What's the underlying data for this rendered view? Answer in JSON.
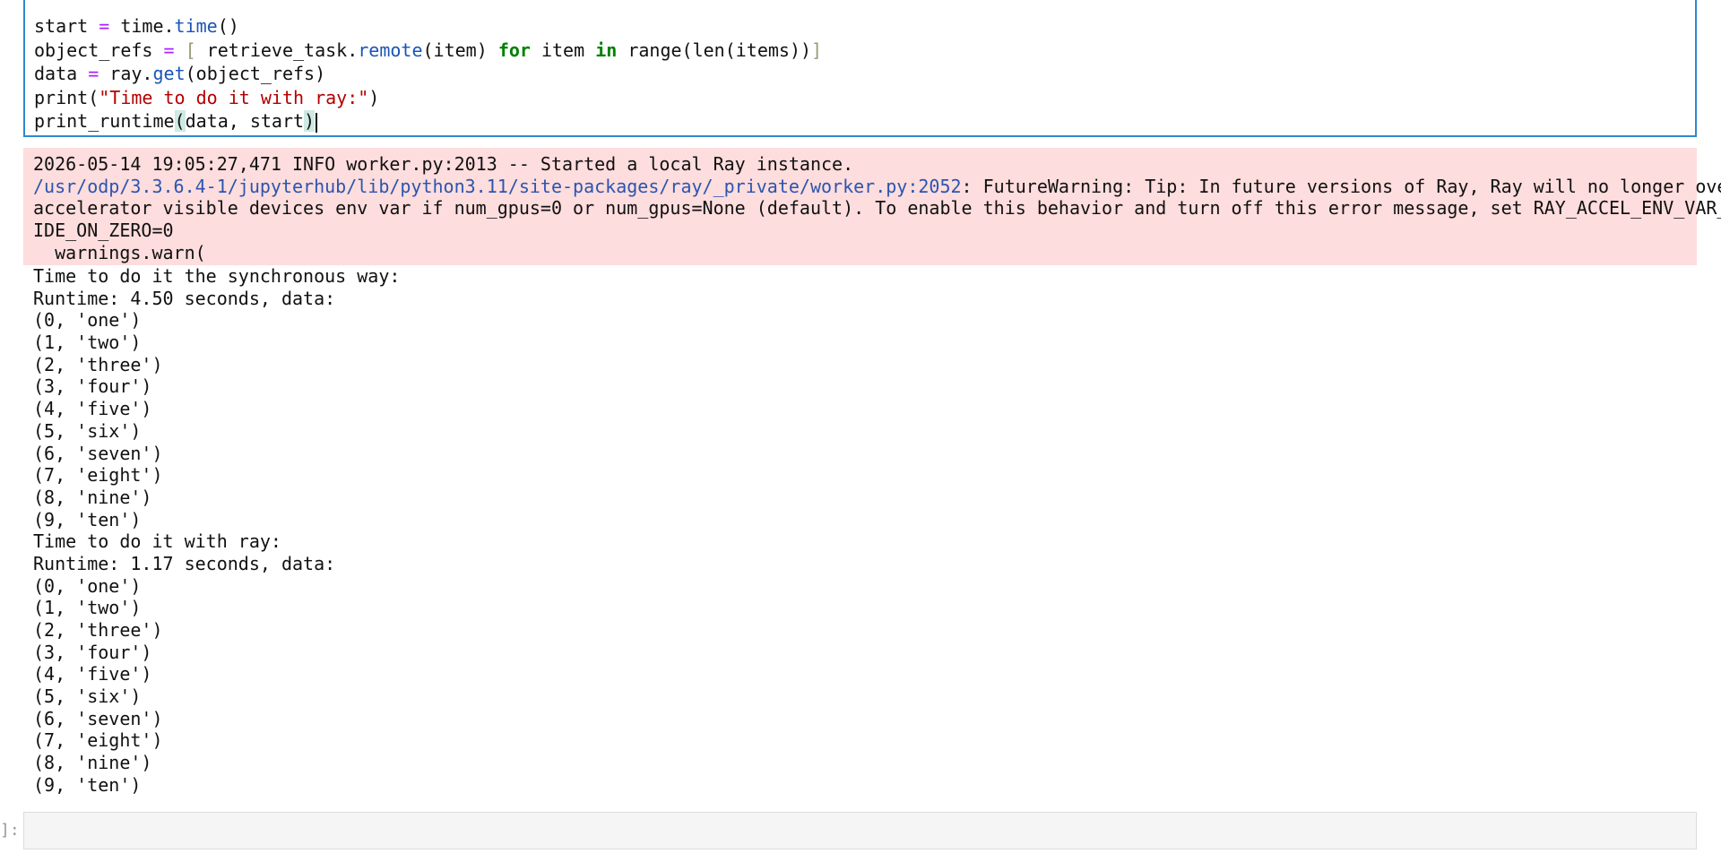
{
  "code_cell": {
    "lines": {
      "l1": {
        "a": "start ",
        "op": "=",
        "b": " time.",
        "call": "time",
        "c": "()"
      },
      "l2": {
        "a": "object_refs ",
        "op": "=",
        "dim1": " [",
        "b": " retrieve_task.",
        "call": "remote",
        "c": "(item) ",
        "kw1": "for",
        "d": " item ",
        "kw2": "in",
        "e": " range(len(items))",
        "dim2": "]"
      },
      "l3": {
        "a": "data ",
        "op": "=",
        "b": " ray.",
        "call": "get",
        "c": "(object_refs)"
      },
      "l4": {
        "a": "print(",
        "str": "\"Time to do it with ray:\"",
        "c": ")"
      },
      "l5": {
        "a": "print_runtime",
        "p1": "(",
        "b": "data, start",
        "p2": ")"
      }
    }
  },
  "output": {
    "stderr": {
      "info": "2026-05-14 19:05:27,471 INFO worker.py:2013 -- Started a local Ray instance.",
      "warn_path": "/usr/odp/3.3.6.4-1/jupyterhub/lib/python3.11/site-packages/ray/_private/worker.py:2052",
      "warn_msg_1": ": FutureWarning: Tip: In future versions of Ray, Ray will no longer override",
      "warn_msg_2": "accelerator visible devices env var if num_gpus=0 or num_gpus=None (default). To enable this behavior and turn off this error message, set RAY_ACCEL_ENV_VAR_OVERR",
      "warn_msg_3": "IDE_ON_ZERO=0",
      "warn_call": "  warnings.warn("
    },
    "stdout": [
      "Time to do it the synchronous way:",
      "Runtime: 4.50 seconds, data:",
      "(0, 'one')",
      "(1, 'two')",
      "(2, 'three')",
      "(3, 'four')",
      "(4, 'five')",
      "(5, 'six')",
      "(6, 'seven')",
      "(7, 'eight')",
      "(8, 'nine')",
      "(9, 'ten')",
      "Time to do it with ray:",
      "Runtime: 1.17 seconds, data:",
      "(0, 'one')",
      "(1, 'two')",
      "(2, 'three')",
      "(3, 'four')",
      "(4, 'five')",
      "(5, 'six')",
      "(6, 'seven')",
      "(7, 'eight')",
      "(8, 'nine')",
      "(9, 'ten')"
    ]
  },
  "empty_cell": {
    "prompt": "]:"
  },
  "colors": {
    "cell_border_active": "#2f87d0",
    "stderr_bg": "#fddddd",
    "keyword": "#008000",
    "string": "#b40000",
    "operator": "#aa22ff",
    "call": "#1a55b5"
  }
}
